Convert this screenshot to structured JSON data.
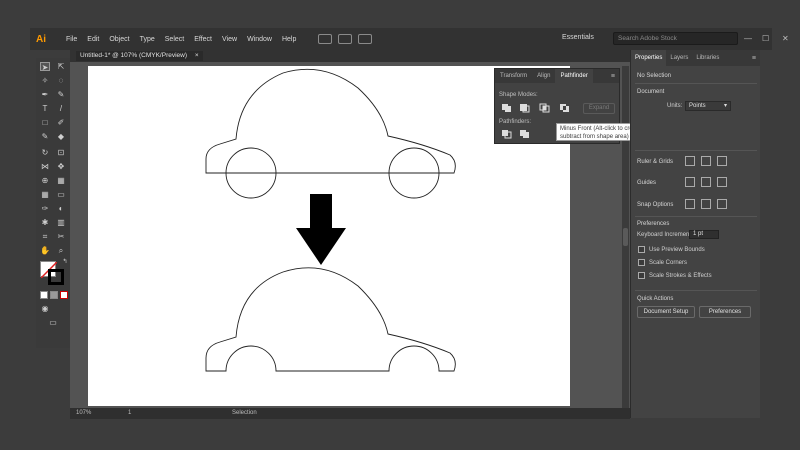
{
  "app": {
    "logo": "Ai"
  },
  "menu": [
    "File",
    "Edit",
    "Object",
    "Type",
    "Select",
    "Effect",
    "View",
    "Window",
    "Help"
  ],
  "workspace": {
    "name": "Essentials",
    "search_placeholder": "Search Adobe Stock"
  },
  "document": {
    "tab_title": "Untitled-1* @ 107% (CMYK/Preview)",
    "tab_close": "×"
  },
  "statusbar": {
    "zoom": "107%",
    "artboard": "1",
    "tool": "Selection"
  },
  "pathfinder": {
    "tabs": [
      "Transform",
      "Align",
      "Pathfinder"
    ],
    "active_tab": "Pathfinder",
    "shape_modes_label": "Shape Modes:",
    "pathfinders_label": "Pathfinders:",
    "expand_label": "Expand",
    "tooltip": "Minus Front (Alt-click to create a Compound Shape and subtract from shape area)"
  },
  "properties": {
    "tabs": [
      "Properties",
      "Layers",
      "Libraries"
    ],
    "active_tab": "Properties",
    "no_selection": "No Selection",
    "document_label": "Document",
    "units_label": "Units:",
    "units_value": "Points",
    "rulers_grids": "Ruler & Grids",
    "guides": "Guides",
    "snap_options": "Snap Options",
    "preferences": "Preferences",
    "keyboard_increment_label": "Keyboard Increment:",
    "keyboard_increment_value": "1 pt",
    "checkboxes": [
      "Use Preview Bounds",
      "Scale Corners",
      "Scale Strokes & Effects"
    ],
    "quick_actions": "Quick Actions",
    "document_setup": "Document Setup",
    "preferences_button": "Preferences"
  },
  "icons": [
    "select-arrow",
    "direct-select",
    "pen",
    "type",
    "rectangle",
    "brush",
    "eraser",
    "rotate",
    "scale",
    "gradient",
    "eyedropper",
    "zoom",
    "hand",
    "fill-stroke"
  ],
  "colors": {
    "artboard": "#ffffff",
    "chrome": "#3c3c3c",
    "panel": "#434343",
    "arrow": "#000000"
  }
}
